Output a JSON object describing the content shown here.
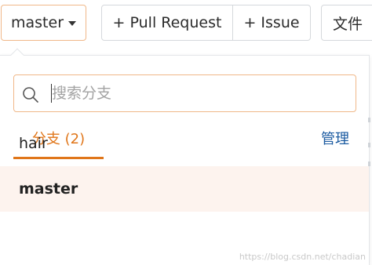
{
  "toolbar": {
    "branch_label": "master",
    "pull_request_label": "+ Pull Request",
    "issue_label": "+ Issue",
    "file_label": "文件"
  },
  "dropdown": {
    "search_placeholder": "搜索分支",
    "tab_branches_label": "分支 (2)",
    "manage_label": "管理",
    "branches": [
      {
        "name": "hair",
        "active": false
      },
      {
        "name": "master",
        "active": true
      }
    ]
  },
  "watermark": "https://blog.csdn.net/chadian",
  "colors": {
    "accent": "#e0761a",
    "accent_border": "#f0b889",
    "link": "#1a5aa0",
    "active_row_bg": "#fdf3ee"
  }
}
